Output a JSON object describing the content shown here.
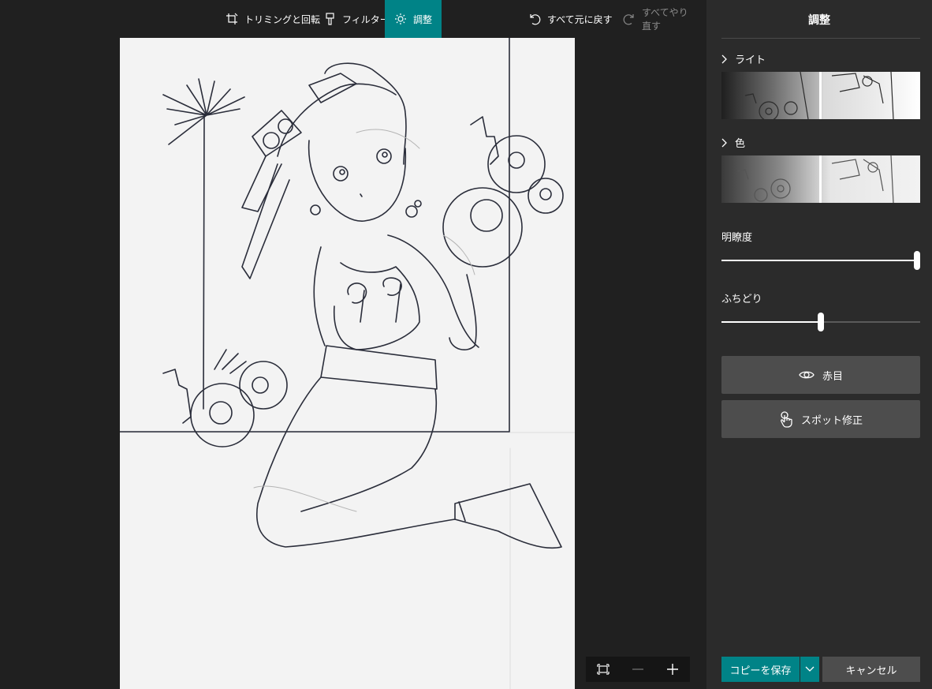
{
  "toolbar": {
    "crop_label": "トリミングと回転",
    "filter_label": "フィルター",
    "adjust_label": "調整",
    "undo_all_label": "すべて元に戻す",
    "redo_all_label": "すべてやり直す"
  },
  "panel": {
    "title": "調整",
    "light_label": "ライト",
    "color_label": "色",
    "clarity_label": "明瞭度",
    "clarity_value": 1.0,
    "vignette_label": "ふちどり",
    "vignette_value": 0.5,
    "redeye_label": "赤目",
    "spotfix_label": "スポット修正",
    "save_label": "コピーを保存",
    "cancel_label": "キャンセル"
  },
  "colors": {
    "accent": "#008387",
    "panel_bg": "#2b2b2b",
    "canvas_bg": "#202020",
    "button_bg": "#4d4d4d"
  },
  "icons": {
    "crop": "crop-rotate-icon",
    "filter": "filter-brush-icon",
    "adjust": "sun-icon",
    "undo": "undo-icon",
    "redo": "redo-icon",
    "chevron": "chevron-right-icon",
    "eye": "eye-icon",
    "touch": "touch-hand-icon",
    "fit": "fit-screen-icon",
    "zoom_out": "minus-icon",
    "zoom_in": "plus-icon"
  }
}
